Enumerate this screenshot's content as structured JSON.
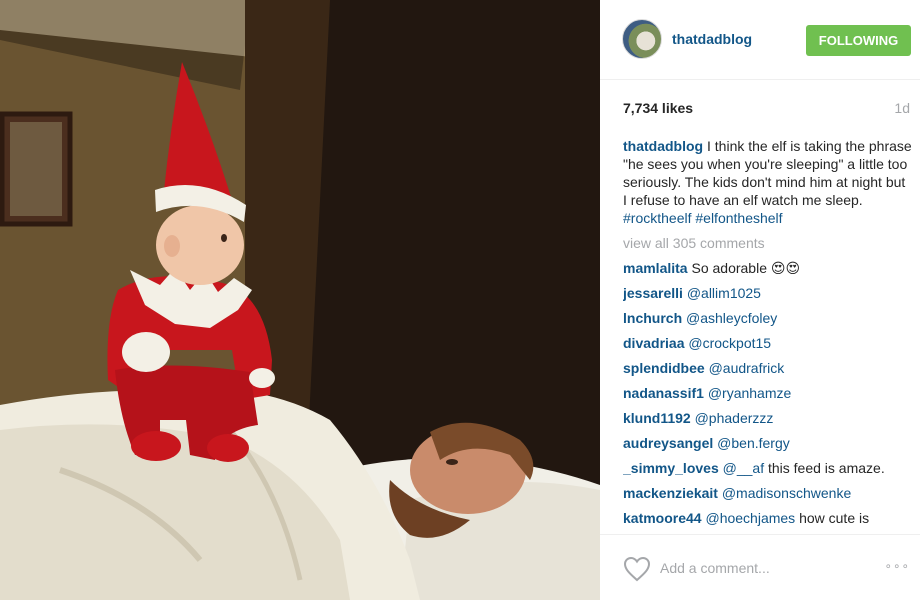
{
  "post": {
    "username": "thatdadblog",
    "follow_label": "FOLLOWING",
    "likes": "7,734 likes",
    "age": "1d",
    "caption_user": "thatdadblog",
    "caption_text": " I think the elf is taking the phrase \"he sees you when you're sleeping\" a little too seriously. The kids don't mind him at night but I refuse to have an elf watch me sleep.",
    "hashtags": [
      "#rocktheelf",
      "#elfontheshelf"
    ],
    "view_all": "view all 305 comments"
  },
  "comments": [
    {
      "user": "mamlalita",
      "mention": "",
      "text": " So adorable 😍😍"
    },
    {
      "user": "jessarelli",
      "mention": " @allim1025",
      "text": ""
    },
    {
      "user": "lnchurch",
      "mention": " @ashleycfoley",
      "text": ""
    },
    {
      "user": "divadriaa",
      "mention": " @crockpot15",
      "text": ""
    },
    {
      "user": "splendidbee",
      "mention": " @audrafrick",
      "text": ""
    },
    {
      "user": "nadanassif1",
      "mention": " @ryanhamze",
      "text": ""
    },
    {
      "user": "klund1192",
      "mention": " @phaderzzz",
      "text": ""
    },
    {
      "user": "audreysangel",
      "mention": " @ben.fergy",
      "text": ""
    },
    {
      "user": "_simmy_loves",
      "mention": " @__af",
      "text": " this feed is amaze."
    },
    {
      "user": "mackenziekait",
      "mention": " @madisonschwenke",
      "text": ""
    },
    {
      "user": "katmoore44",
      "mention": " @hoechjames",
      "text": " how cute is"
    }
  ],
  "footer": {
    "add_comment_placeholder": "Add a comment...",
    "more_label": "∘∘∘"
  },
  "icons": {
    "heart": "heart-outline-icon",
    "more": "more-options-icon"
  },
  "colors": {
    "link_blue": "#125688",
    "follow_green": "#70c050",
    "muted_gray": "#a5a7aa",
    "elf_red": "#c8161d"
  }
}
